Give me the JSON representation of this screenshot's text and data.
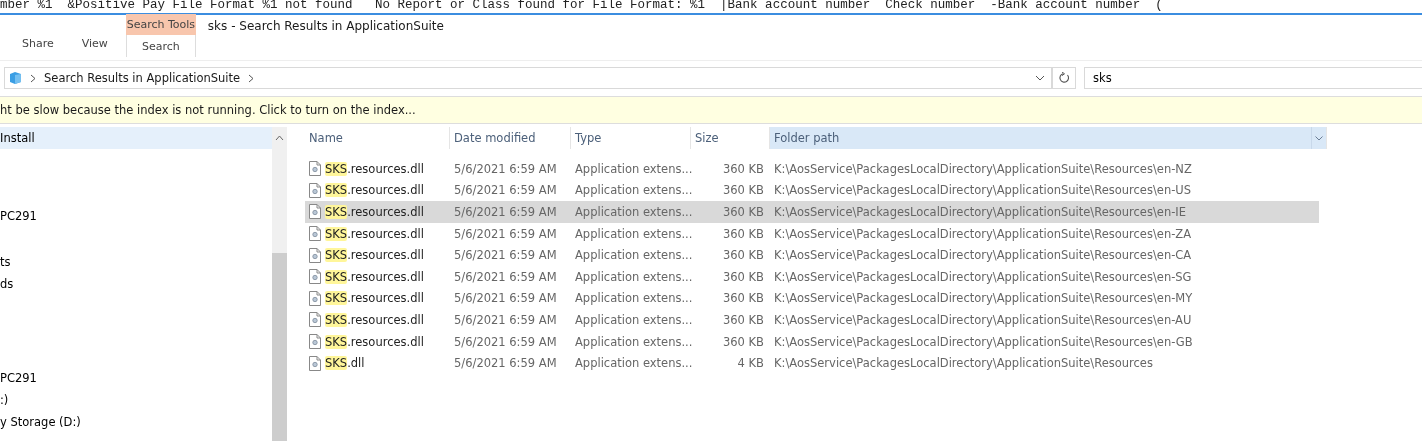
{
  "background_window": {
    "text": "mber %1  &Positive Pay File Format %1 not found   No Report or Class found for File Format: %1  |Bank account number  Check number  -Bank account number  ("
  },
  "window": {
    "title": "sks - Search Results in ApplicationSuite"
  },
  "ribbon": {
    "context_label": "Search Tools",
    "tabs": [
      {
        "label": "Share",
        "selected": false
      },
      {
        "label": "View",
        "selected": false
      },
      {
        "label": "Search",
        "selected": true
      }
    ]
  },
  "address_bar": {
    "path": "Search Results in ApplicationSuite"
  },
  "search": {
    "value": "sks"
  },
  "info_bar": {
    "text": "ht be slow because the index is not running.  Click to turn on the index..."
  },
  "sidebar": {
    "items": [
      {
        "label": "Install",
        "selected": true
      },
      {
        "label": "PC291",
        "selected": false
      },
      {
        "label": "ts",
        "selected": false
      },
      {
        "label": "ds",
        "selected": false
      },
      {
        "label": "PC291",
        "selected": false
      },
      {
        "label": ":)",
        "selected": false
      },
      {
        "label": "y Storage (D:)",
        "selected": false
      }
    ]
  },
  "table": {
    "columns": [
      {
        "label": "Name",
        "sorted": false
      },
      {
        "label": "Date modified",
        "sorted": false
      },
      {
        "label": "Type",
        "sorted": false
      },
      {
        "label": "Size",
        "sorted": false
      },
      {
        "label": "Folder path",
        "sorted": true
      }
    ],
    "rows": [
      {
        "name_match": "SKS",
        "name_rest": ".resources.dll",
        "date": "5/6/2021 6:59 AM",
        "type": "Application extens...",
        "size": "360 KB",
        "path": "K:\\AosService\\PackagesLocalDirectory\\ApplicationSuite\\Resources\\en-NZ",
        "selected": false
      },
      {
        "name_match": "SKS",
        "name_rest": ".resources.dll",
        "date": "5/6/2021 6:59 AM",
        "type": "Application extens...",
        "size": "360 KB",
        "path": "K:\\AosService\\PackagesLocalDirectory\\ApplicationSuite\\Resources\\en-US",
        "selected": false
      },
      {
        "name_match": "SKS",
        "name_rest": ".resources.dll",
        "date": "5/6/2021 6:59 AM",
        "type": "Application extens...",
        "size": "360 KB",
        "path": "K:\\AosService\\PackagesLocalDirectory\\ApplicationSuite\\Resources\\en-IE",
        "selected": true
      },
      {
        "name_match": "SKS",
        "name_rest": ".resources.dll",
        "date": "5/6/2021 6:59 AM",
        "type": "Application extens...",
        "size": "360 KB",
        "path": "K:\\AosService\\PackagesLocalDirectory\\ApplicationSuite\\Resources\\en-ZA",
        "selected": false
      },
      {
        "name_match": "SKS",
        "name_rest": ".resources.dll",
        "date": "5/6/2021 6:59 AM",
        "type": "Application extens...",
        "size": "360 KB",
        "path": "K:\\AosService\\PackagesLocalDirectory\\ApplicationSuite\\Resources\\en-CA",
        "selected": false
      },
      {
        "name_match": "SKS",
        "name_rest": ".resources.dll",
        "date": "5/6/2021 6:59 AM",
        "type": "Application extens...",
        "size": "360 KB",
        "path": "K:\\AosService\\PackagesLocalDirectory\\ApplicationSuite\\Resources\\en-SG",
        "selected": false
      },
      {
        "name_match": "SKS",
        "name_rest": ".resources.dll",
        "date": "5/6/2021 6:59 AM",
        "type": "Application extens...",
        "size": "360 KB",
        "path": "K:\\AosService\\PackagesLocalDirectory\\ApplicationSuite\\Resources\\en-MY",
        "selected": false
      },
      {
        "name_match": "SKS",
        "name_rest": ".resources.dll",
        "date": "5/6/2021 6:59 AM",
        "type": "Application extens...",
        "size": "360 KB",
        "path": "K:\\AosService\\PackagesLocalDirectory\\ApplicationSuite\\Resources\\en-AU",
        "selected": false
      },
      {
        "name_match": "SKS",
        "name_rest": ".resources.dll",
        "date": "5/6/2021 6:59 AM",
        "type": "Application extens...",
        "size": "360 KB",
        "path": "K:\\AosService\\PackagesLocalDirectory\\ApplicationSuite\\Resources\\en-GB",
        "selected": false
      },
      {
        "name_match": "SKS",
        "name_rest": ".dll",
        "date": "5/6/2021 6:59 AM",
        "type": "Application extens...",
        "size": "4 KB",
        "path": "K:\\AosService\\PackagesLocalDirectory\\ApplicationSuite\\Resources",
        "selected": false
      }
    ]
  }
}
